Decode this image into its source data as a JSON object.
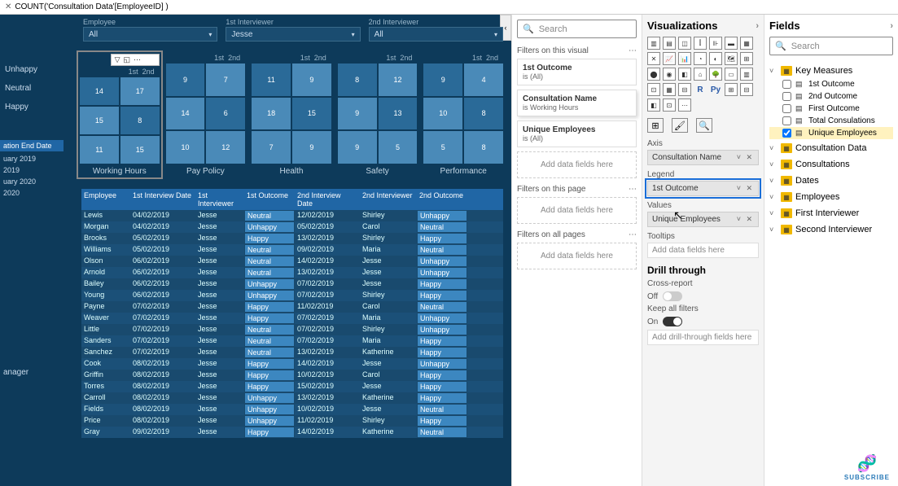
{
  "formula_bar": {
    "prefix": "COUNT(",
    "expr": "'Consultation Data'[EmployeeID] )"
  },
  "panes": {
    "viz_title": "Visualizations",
    "fields_title": "Fields",
    "search_placeholder": "Search"
  },
  "slicers": [
    {
      "label": "Employee",
      "value": "All"
    },
    {
      "label": "1st Interviewer",
      "value": "Jesse"
    },
    {
      "label": "2nd Interviewer",
      "value": "All"
    }
  ],
  "left_filters": [
    "Unhappy",
    "Neutral",
    "Happy"
  ],
  "left_date_header": "ation End Date",
  "left_years": [
    "uary 2019",
    "2019",
    "uary 2020",
    "2020"
  ],
  "left_bottom": "anager",
  "treemaps": [
    {
      "label": "Working Hours",
      "selected": true,
      "header": [
        "1st",
        "2nd"
      ],
      "cells": [
        "14",
        "17",
        "15",
        "8",
        "11",
        "15"
      ]
    },
    {
      "label": "Pay Policy",
      "header": [
        "1st",
        "2nd"
      ],
      "cells": [
        "9",
        "7",
        "14",
        "6",
        "10",
        "12"
      ]
    },
    {
      "label": "Health",
      "header": [
        "1st",
        "2nd"
      ],
      "cells": [
        "11",
        "9",
        "18",
        "15",
        "7",
        "9"
      ]
    },
    {
      "label": "Safety",
      "header": [
        "1st",
        "2nd"
      ],
      "cells": [
        "8",
        "12",
        "9",
        "13",
        "9",
        "5"
      ]
    },
    {
      "label": "Performance",
      "header": [
        "1st",
        "2nd"
      ],
      "cells": [
        "9",
        "4",
        "10",
        "8",
        "5",
        "8"
      ]
    }
  ],
  "table": {
    "headers": [
      "Employee",
      "1st Interview Date",
      "1st Interviewer",
      "1st Outcome",
      "2nd Interview Date",
      "2nd Interviewer",
      "2nd Outcome"
    ],
    "rows": [
      [
        "Lewis",
        "04/02/2019",
        "Jesse",
        "Neutral",
        "12/02/2019",
        "Shirley",
        "Unhappy"
      ],
      [
        "Morgan",
        "04/02/2019",
        "Jesse",
        "Unhappy",
        "05/02/2019",
        "Carol",
        "Neutral"
      ],
      [
        "Brooks",
        "05/02/2019",
        "Jesse",
        "Happy",
        "13/02/2019",
        "Shirley",
        "Happy"
      ],
      [
        "Williams",
        "05/02/2019",
        "Jesse",
        "Neutral",
        "09/02/2019",
        "Maria",
        "Neutral"
      ],
      [
        "Olson",
        "06/02/2019",
        "Jesse",
        "Neutral",
        "14/02/2019",
        "Jesse",
        "Unhappy"
      ],
      [
        "Arnold",
        "06/02/2019",
        "Jesse",
        "Neutral",
        "13/02/2019",
        "Jesse",
        "Unhappy"
      ],
      [
        "Bailey",
        "06/02/2019",
        "Jesse",
        "Unhappy",
        "07/02/2019",
        "Jesse",
        "Happy"
      ],
      [
        "Young",
        "06/02/2019",
        "Jesse",
        "Unhappy",
        "07/02/2019",
        "Shirley",
        "Happy"
      ],
      [
        "Payne",
        "07/02/2019",
        "Jesse",
        "Happy",
        "11/02/2019",
        "Carol",
        "Neutral"
      ],
      [
        "Weaver",
        "07/02/2019",
        "Jesse",
        "Happy",
        "07/02/2019",
        "Maria",
        "Unhappy"
      ],
      [
        "Little",
        "07/02/2019",
        "Jesse",
        "Neutral",
        "07/02/2019",
        "Shirley",
        "Unhappy"
      ],
      [
        "Sanders",
        "07/02/2019",
        "Jesse",
        "Neutral",
        "07/02/2019",
        "Maria",
        "Happy"
      ],
      [
        "Sanchez",
        "07/02/2019",
        "Jesse",
        "Neutral",
        "13/02/2019",
        "Katherine",
        "Happy"
      ],
      [
        "Cook",
        "08/02/2019",
        "Jesse",
        "Happy",
        "14/02/2019",
        "Jesse",
        "Unhappy"
      ],
      [
        "Griffin",
        "08/02/2019",
        "Jesse",
        "Happy",
        "10/02/2019",
        "Carol",
        "Happy"
      ],
      [
        "Torres",
        "08/02/2019",
        "Jesse",
        "Happy",
        "15/02/2019",
        "Jesse",
        "Happy"
      ],
      [
        "Carroll",
        "08/02/2019",
        "Jesse",
        "Unhappy",
        "13/02/2019",
        "Katherine",
        "Happy"
      ],
      [
        "Fields",
        "08/02/2019",
        "Jesse",
        "Unhappy",
        "10/02/2019",
        "Jesse",
        "Neutral"
      ],
      [
        "Price",
        "08/02/2019",
        "Jesse",
        "Unhappy",
        "11/02/2019",
        "Shirley",
        "Happy"
      ],
      [
        "Gray",
        "09/02/2019",
        "Jesse",
        "Happy",
        "14/02/2019",
        "Katherine",
        "Neutral"
      ]
    ]
  },
  "filters": {
    "visual_title": "Filters on this visual",
    "visual": [
      {
        "name": "1st Outcome",
        "val": "is (All)"
      },
      {
        "name": "Consultation Name",
        "val": "is Working Hours",
        "active": true
      },
      {
        "name": "Unique Employees",
        "val": "is (All)"
      }
    ],
    "page_title": "Filters on this page",
    "all_title": "Filters on all pages",
    "drop_text": "Add data fields here"
  },
  "viz": {
    "wells": {
      "axis_label": "Axis",
      "axis_value": "Consultation Name",
      "legend_label": "Legend",
      "legend_value": "1st Outcome",
      "values_label": "Values",
      "values_value": "Unique Employees",
      "tooltips_label": "Tooltips",
      "tooltips_placeholder": "Add data fields here"
    },
    "drill": {
      "title": "Drill through",
      "cross": "Cross-report",
      "cross_state": "Off",
      "keep": "Keep all filters",
      "keep_state": "On",
      "placeholder": "Add drill-through fields here"
    }
  },
  "fields": {
    "groups": [
      {
        "name": "Key Measures",
        "expanded": true,
        "items": [
          {
            "name": "1st Outcome",
            "checked": false
          },
          {
            "name": "2nd Outcome",
            "checked": false
          },
          {
            "name": "First Outcome",
            "checked": false
          },
          {
            "name": "Total Consulations",
            "checked": false
          },
          {
            "name": "Unique Employees",
            "checked": true,
            "sel": true
          }
        ]
      },
      {
        "name": "Consultation Data",
        "expanded": false
      },
      {
        "name": "Consultations",
        "expanded": false
      },
      {
        "name": "Dates",
        "expanded": false
      },
      {
        "name": "Employees",
        "expanded": false
      },
      {
        "name": "First Interviewer",
        "expanded": false
      },
      {
        "name": "Second Interviewer",
        "expanded": false
      }
    ]
  },
  "subscribe": "SUBSCRIBE"
}
